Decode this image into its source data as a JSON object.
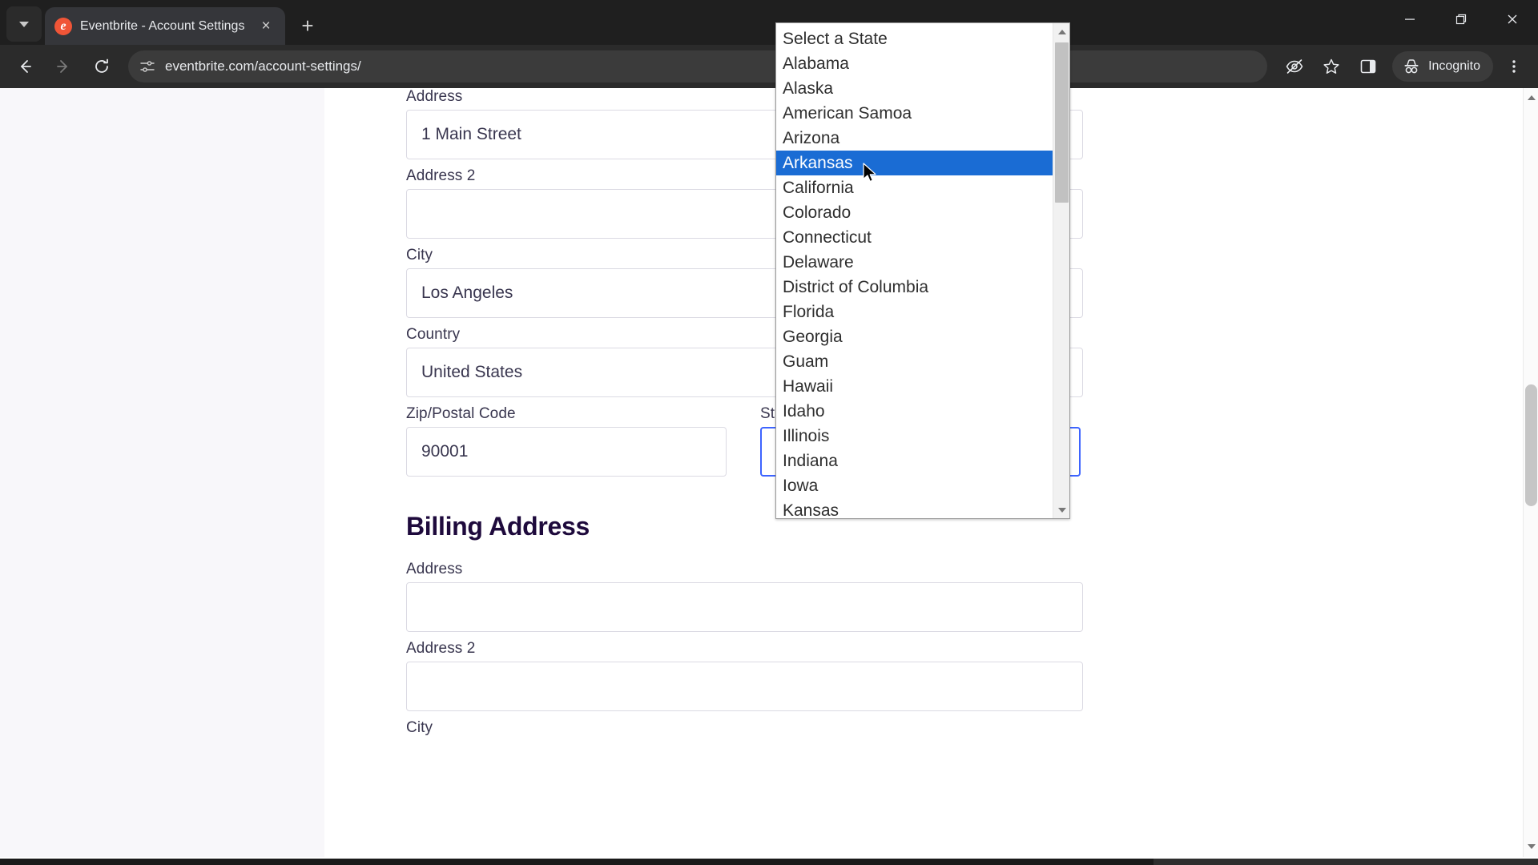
{
  "browser": {
    "tab": {
      "title": "Eventbrite - Account Settings",
      "favicon_letter": "e",
      "favicon_color": "#f05537",
      "close_label": "×"
    },
    "new_tab_label": "+",
    "tab_search_icon": "chevron-down-icon",
    "window_controls": {
      "minimize": "—",
      "maximize": "❐",
      "close": "✕"
    },
    "toolbar": {
      "back_label": "←",
      "forward_label": "→",
      "reload_label": "⟳",
      "url": "eventbrite.com/account-settings/",
      "site_info_icon": "tune-icon",
      "eye_off_icon": "eye-off-icon",
      "bookmark_icon": "star-icon",
      "side_panel_icon": "side-panel-icon",
      "incognito_label": "Incognito",
      "incognito_icon": "incognito-hat-icon",
      "menu_icon": "three-dot-menu-icon"
    }
  },
  "page": {
    "shipping_section": {
      "fields": [
        {
          "label": "Address",
          "value": "1 Main Street"
        },
        {
          "label": "Address 2",
          "value": ""
        },
        {
          "label": "City",
          "value": "Los Angeles"
        },
        {
          "label": "Country",
          "value": "United States"
        }
      ],
      "zip": {
        "label": "Zip/Postal Code",
        "value": "90001"
      },
      "state": {
        "label": "State",
        "value": "Select a State",
        "chevron_icon": "chevron-down-icon"
      }
    },
    "billing_section": {
      "heading": "Billing Address",
      "fields": [
        {
          "label": "Address",
          "value": ""
        },
        {
          "label": "Address 2",
          "value": ""
        },
        {
          "label": "City",
          "value": ""
        }
      ]
    }
  },
  "state_dropdown": {
    "selected": "Arkansas",
    "options": [
      "Select a State",
      "Alabama",
      "Alaska",
      "American Samoa",
      "Arizona",
      "Arkansas",
      "California",
      "Colorado",
      "Connecticut",
      "Delaware",
      "District of Columbia",
      "Florida",
      "Georgia",
      "Guam",
      "Hawaii",
      "Idaho",
      "Illinois",
      "Indiana",
      "Iowa",
      "Kansas"
    ],
    "highlight_color": "#1a6cd4"
  },
  "colors": {
    "accent_focus": "#3d64ff",
    "heading": "#1e0a3c",
    "label_text": "#39364f",
    "brand": "#f05537"
  }
}
